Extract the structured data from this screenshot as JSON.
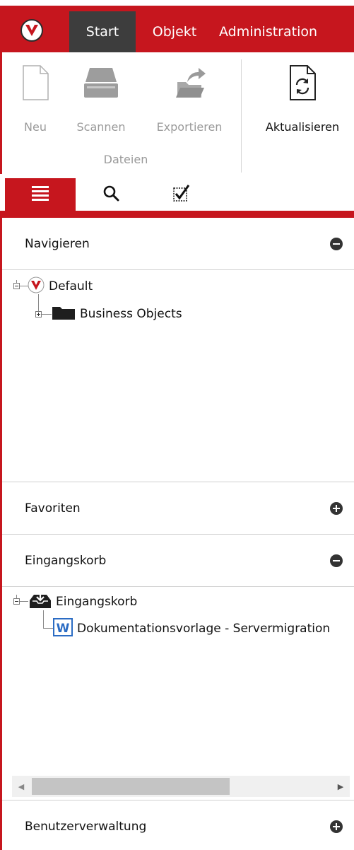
{
  "ribbon_tabs": {
    "start": "Start",
    "objekt": "Objekt",
    "administration": "Administration"
  },
  "ribbon": {
    "new_label": "Neu",
    "scan_label": "Scannen",
    "export_label": "Exportieren",
    "group_label": "Dateien",
    "refresh_label": "Aktualisieren"
  },
  "modes": {
    "list_icon": "list-icon",
    "search_icon": "search-icon",
    "tasks_icon": "checkbox-icon"
  },
  "sections": {
    "navigate": {
      "title": "Navigieren",
      "state": "expanded",
      "tree": {
        "root": "Default",
        "child": "Business Objects"
      }
    },
    "favorites": {
      "title": "Favoriten",
      "state": "collapsed"
    },
    "inbox": {
      "title": "Eingangskorb",
      "state": "expanded",
      "tree": {
        "root": "Eingangskorb",
        "child": "Dokumentationsvorlage - Servermigration"
      }
    },
    "user_admin": {
      "title": "Benutzerverwaltung",
      "state": "collapsed"
    }
  },
  "colors": {
    "accent": "#c6161e",
    "active_tab": "#3d3d3d",
    "disabled_text": "#9a9a9a",
    "word_blue": "#2b6cc4"
  }
}
